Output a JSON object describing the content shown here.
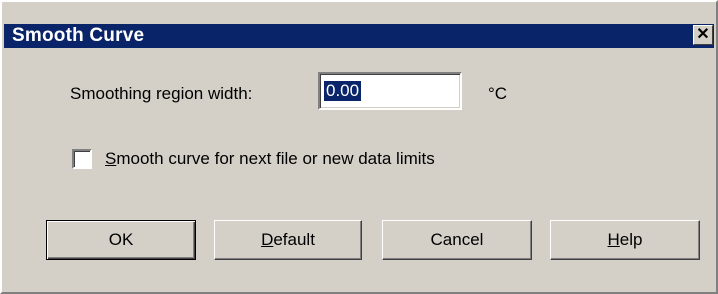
{
  "window": {
    "title": "Smooth Curve",
    "close_glyph": "✕"
  },
  "smoothing": {
    "label": "Smoothing region width:",
    "value": "0.00",
    "unit": "°C"
  },
  "option": {
    "accel": "S",
    "label_rest": "mooth curve for next file or new data limits",
    "checked": false
  },
  "buttons": {
    "ok": "OK",
    "default_accel": "D",
    "default_rest": "efault",
    "cancel": "Cancel",
    "help_accel": "H",
    "help_rest": "elp"
  },
  "colors": {
    "titlebar": "#0a246a",
    "face": "#d4d0c8",
    "selection": "#0a246a"
  }
}
